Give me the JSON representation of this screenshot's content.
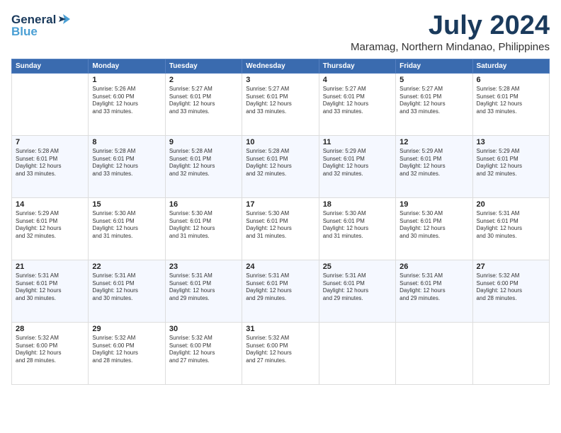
{
  "logo": {
    "line1": "General",
    "line2": "Blue"
  },
  "title": "July 2024",
  "location": "Maramag, Northern Mindanao, Philippines",
  "columns": [
    "Sunday",
    "Monday",
    "Tuesday",
    "Wednesday",
    "Thursday",
    "Friday",
    "Saturday"
  ],
  "weeks": [
    [
      {
        "day": "",
        "info": ""
      },
      {
        "day": "1",
        "info": "Sunrise: 5:26 AM\nSunset: 6:00 PM\nDaylight: 12 hours\nand 33 minutes."
      },
      {
        "day": "2",
        "info": "Sunrise: 5:27 AM\nSunset: 6:01 PM\nDaylight: 12 hours\nand 33 minutes."
      },
      {
        "day": "3",
        "info": "Sunrise: 5:27 AM\nSunset: 6:01 PM\nDaylight: 12 hours\nand 33 minutes."
      },
      {
        "day": "4",
        "info": "Sunrise: 5:27 AM\nSunset: 6:01 PM\nDaylight: 12 hours\nand 33 minutes."
      },
      {
        "day": "5",
        "info": "Sunrise: 5:27 AM\nSunset: 6:01 PM\nDaylight: 12 hours\nand 33 minutes."
      },
      {
        "day": "6",
        "info": "Sunrise: 5:28 AM\nSunset: 6:01 PM\nDaylight: 12 hours\nand 33 minutes."
      }
    ],
    [
      {
        "day": "7",
        "info": "Sunrise: 5:28 AM\nSunset: 6:01 PM\nDaylight: 12 hours\nand 33 minutes."
      },
      {
        "day": "8",
        "info": "Sunrise: 5:28 AM\nSunset: 6:01 PM\nDaylight: 12 hours\nand 33 minutes."
      },
      {
        "day": "9",
        "info": "Sunrise: 5:28 AM\nSunset: 6:01 PM\nDaylight: 12 hours\nand 32 minutes."
      },
      {
        "day": "10",
        "info": "Sunrise: 5:28 AM\nSunset: 6:01 PM\nDaylight: 12 hours\nand 32 minutes."
      },
      {
        "day": "11",
        "info": "Sunrise: 5:29 AM\nSunset: 6:01 PM\nDaylight: 12 hours\nand 32 minutes."
      },
      {
        "day": "12",
        "info": "Sunrise: 5:29 AM\nSunset: 6:01 PM\nDaylight: 12 hours\nand 32 minutes."
      },
      {
        "day": "13",
        "info": "Sunrise: 5:29 AM\nSunset: 6:01 PM\nDaylight: 12 hours\nand 32 minutes."
      }
    ],
    [
      {
        "day": "14",
        "info": "Sunrise: 5:29 AM\nSunset: 6:01 PM\nDaylight: 12 hours\nand 32 minutes."
      },
      {
        "day": "15",
        "info": "Sunrise: 5:30 AM\nSunset: 6:01 PM\nDaylight: 12 hours\nand 31 minutes."
      },
      {
        "day": "16",
        "info": "Sunrise: 5:30 AM\nSunset: 6:01 PM\nDaylight: 12 hours\nand 31 minutes."
      },
      {
        "day": "17",
        "info": "Sunrise: 5:30 AM\nSunset: 6:01 PM\nDaylight: 12 hours\nand 31 minutes."
      },
      {
        "day": "18",
        "info": "Sunrise: 5:30 AM\nSunset: 6:01 PM\nDaylight: 12 hours\nand 31 minutes."
      },
      {
        "day": "19",
        "info": "Sunrise: 5:30 AM\nSunset: 6:01 PM\nDaylight: 12 hours\nand 30 minutes."
      },
      {
        "day": "20",
        "info": "Sunrise: 5:31 AM\nSunset: 6:01 PM\nDaylight: 12 hours\nand 30 minutes."
      }
    ],
    [
      {
        "day": "21",
        "info": "Sunrise: 5:31 AM\nSunset: 6:01 PM\nDaylight: 12 hours\nand 30 minutes."
      },
      {
        "day": "22",
        "info": "Sunrise: 5:31 AM\nSunset: 6:01 PM\nDaylight: 12 hours\nand 30 minutes."
      },
      {
        "day": "23",
        "info": "Sunrise: 5:31 AM\nSunset: 6:01 PM\nDaylight: 12 hours\nand 29 minutes."
      },
      {
        "day": "24",
        "info": "Sunrise: 5:31 AM\nSunset: 6:01 PM\nDaylight: 12 hours\nand 29 minutes."
      },
      {
        "day": "25",
        "info": "Sunrise: 5:31 AM\nSunset: 6:01 PM\nDaylight: 12 hours\nand 29 minutes."
      },
      {
        "day": "26",
        "info": "Sunrise: 5:31 AM\nSunset: 6:01 PM\nDaylight: 12 hours\nand 29 minutes."
      },
      {
        "day": "27",
        "info": "Sunrise: 5:32 AM\nSunset: 6:00 PM\nDaylight: 12 hours\nand 28 minutes."
      }
    ],
    [
      {
        "day": "28",
        "info": "Sunrise: 5:32 AM\nSunset: 6:00 PM\nDaylight: 12 hours\nand 28 minutes."
      },
      {
        "day": "29",
        "info": "Sunrise: 5:32 AM\nSunset: 6:00 PM\nDaylight: 12 hours\nand 28 minutes."
      },
      {
        "day": "30",
        "info": "Sunrise: 5:32 AM\nSunset: 6:00 PM\nDaylight: 12 hours\nand 27 minutes."
      },
      {
        "day": "31",
        "info": "Sunrise: 5:32 AM\nSunset: 6:00 PM\nDaylight: 12 hours\nand 27 minutes."
      },
      {
        "day": "",
        "info": ""
      },
      {
        "day": "",
        "info": ""
      },
      {
        "day": "",
        "info": ""
      }
    ]
  ]
}
